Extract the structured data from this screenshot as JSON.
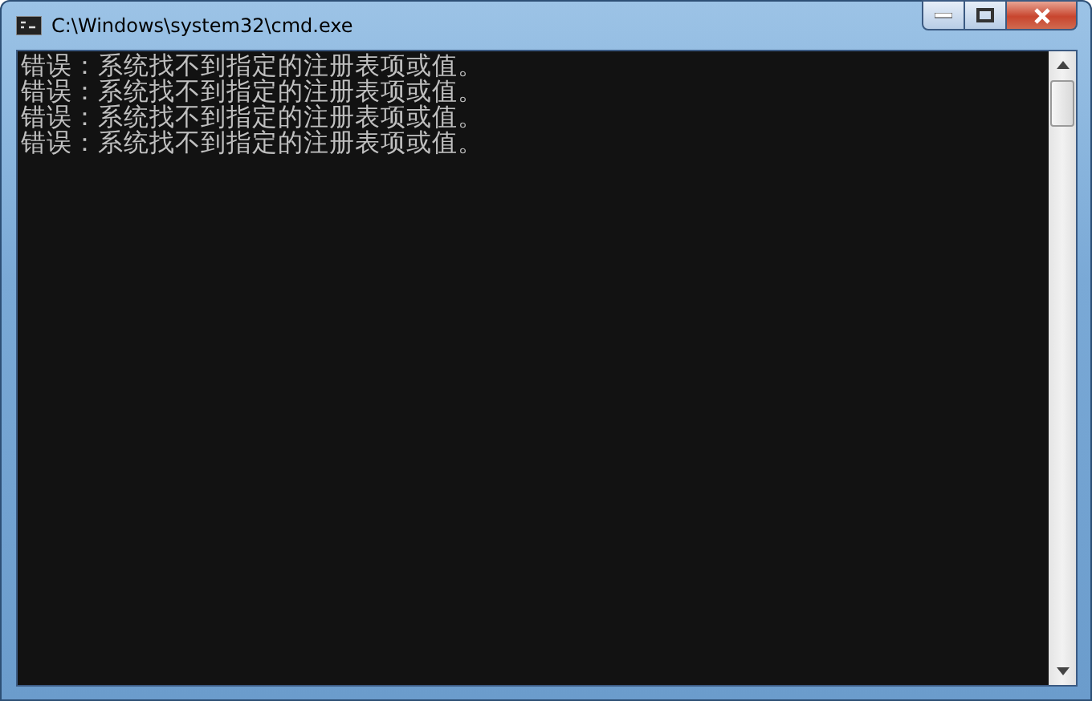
{
  "window": {
    "title": "C:\\Windows\\system32\\cmd.exe"
  },
  "console": {
    "lines": [
      "错误：系统找不到指定的注册表项或值。",
      "错误：系统找不到指定的注册表项或值。",
      "错误：系统找不到指定的注册表项或值。",
      "错误：系统找不到指定的注册表项或值。"
    ]
  }
}
